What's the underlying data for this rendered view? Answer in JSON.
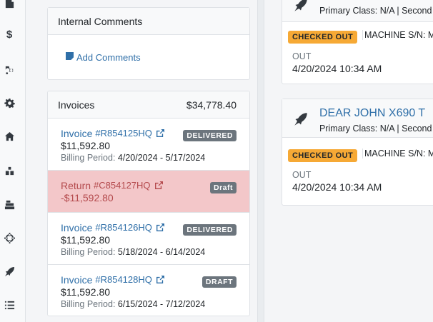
{
  "sidebar": {
    "icons": [
      "building-icon",
      "dollar-icon",
      "tractor-icon",
      "gear-icon",
      "home-icon",
      "warehouse-icon",
      "cash-register-icon",
      "crosshairs-icon",
      "rocket-icon",
      "list-icon"
    ],
    "dollar_glyph": "$"
  },
  "comments": {
    "title": "Internal Comments",
    "add_label": "Add Comments"
  },
  "invoices": {
    "title": "Invoices",
    "total": "$34,778.40",
    "billing_label": "Billing Period:",
    "rows": [
      {
        "kind": "Invoice",
        "number": "#R854125HQ",
        "amount": "$11,592.80",
        "period": "4/20/2024 - 5/17/2024",
        "status": "DELIVERED"
      },
      {
        "kind": "Return",
        "number": "#C854127HQ",
        "amount": "-$11,592.80",
        "period": "",
        "status": "Draft"
      },
      {
        "kind": "Invoice",
        "number": "#R854126HQ",
        "amount": "$11,592.80",
        "period": "5/18/2024 - 6/14/2024",
        "status": "DELIVERED"
      },
      {
        "kind": "Invoice",
        "number": "#R854128HQ",
        "amount": "$11,592.80",
        "period": "6/15/2024 - 7/12/2024",
        "status": "DRAFT"
      }
    ]
  },
  "equipment": [
    {
      "title": "",
      "subtitle": "Primary Class: N/A | Second",
      "status": "CHECKED OUT",
      "serial": "MACHINE S/N: M",
      "out_label": "OUT",
      "out_time": "4/20/2024 10:34 AM"
    },
    {
      "title": "DEAR JOHN X690 T",
      "subtitle": "Primary Class: N/A | Second",
      "status": "CHECKED OUT",
      "serial": "MACHINE S/N: M",
      "out_label": "OUT",
      "out_time": "4/20/2024 10:34 AM"
    }
  ],
  "colors": {
    "link": "#2f6fa8",
    "checked_out": "#f6a935",
    "return_bg": "#f3c7c9",
    "badge": "#6c757d"
  }
}
